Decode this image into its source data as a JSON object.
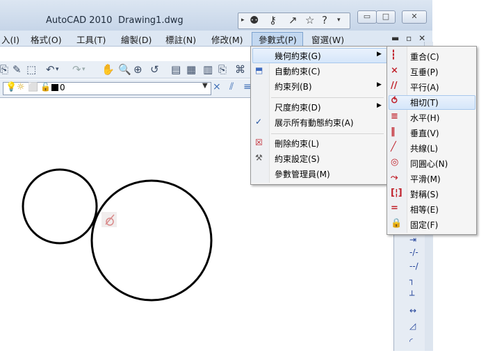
{
  "window": {
    "app_title": "AutoCAD 2010",
    "doc_title": "Drawing1.dwg",
    "minimize": "▭",
    "maximize": "□",
    "close": "✕",
    "infocenter_icons": [
      "binoculars-icon",
      "key-icon",
      "satellite-icon",
      "star-icon",
      "help-icon"
    ]
  },
  "menubar": {
    "items": [
      "入(I)",
      "格式(O)",
      "工具(T)",
      "繪製(D)",
      "標註(N)",
      "修改(M)",
      "參數式(P)",
      "窗選(W)"
    ],
    "active_index": 6,
    "mdi_controls": "▬ ▫ ✕"
  },
  "toolbar": {
    "layer_value": "0"
  },
  "parametric_menu": {
    "items": [
      {
        "label": "幾何約束(G)",
        "submenu": true,
        "icon": ""
      },
      {
        "label": "自動約束(C)",
        "submenu": false,
        "icon": "auto-constrain-icon"
      },
      {
        "label": "約束列(B)",
        "submenu": true,
        "icon": ""
      },
      {
        "label": "尺度約束(D)",
        "submenu": true,
        "icon": ""
      },
      {
        "label": "展示所有動態約束(A)",
        "submenu": false,
        "icon": "checkmark-icon",
        "checked": true
      },
      {
        "label": "刪除約束(L)",
        "submenu": false,
        "icon": "delete-constraint-icon"
      },
      {
        "label": "約束設定(S)",
        "submenu": false,
        "icon": "constraint-settings-icon"
      },
      {
        "label": "參數管理員(M)",
        "submenu": false,
        "icon": ""
      }
    ]
  },
  "geometric_submenu": {
    "items": [
      {
        "label": "重合(C)",
        "icon": "coincident-icon"
      },
      {
        "label": "互垂(P)",
        "icon": "perpendicular-icon"
      },
      {
        "label": "平行(A)",
        "icon": "parallel-icon"
      },
      {
        "label": "相切(T)",
        "icon": "tangent-icon",
        "highlighted": true
      },
      {
        "label": "水平(H)",
        "icon": "horizontal-icon"
      },
      {
        "label": "垂直(V)",
        "icon": "vertical-icon"
      },
      {
        "label": "共線(L)",
        "icon": "collinear-icon"
      },
      {
        "label": "同圓心(N)",
        "icon": "concentric-icon"
      },
      {
        "label": "平滑(M)",
        "icon": "smooth-icon"
      },
      {
        "label": "對稱(S)",
        "icon": "symmetric-icon"
      },
      {
        "label": "相等(E)",
        "icon": "equal-icon"
      },
      {
        "label": "固定(F)",
        "icon": "fix-icon"
      }
    ]
  },
  "colors": {
    "menu_highlight": "#d5e6fa",
    "constraint_red": "#c0202a",
    "title_bar": "#c6d5e8"
  }
}
